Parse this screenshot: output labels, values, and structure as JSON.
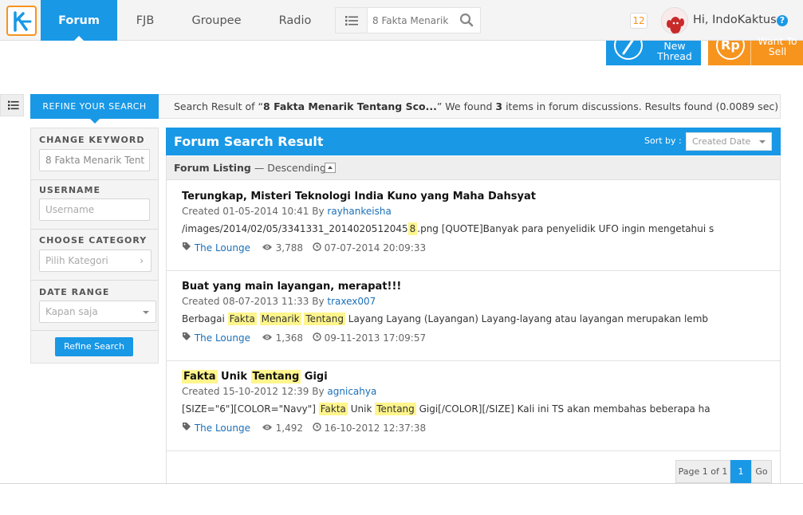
{
  "nav": {
    "tabs": [
      {
        "label": "Forum"
      },
      {
        "label": "FJB"
      },
      {
        "label": "Groupee"
      },
      {
        "label": "Radio"
      }
    ],
    "search_value": "8 Fakta Menarik",
    "notification_count": "12",
    "greeting": "Hi, IndoKaktus",
    "help": "?"
  },
  "actions": {
    "new_thread_line1": "New",
    "new_thread_line2": "Thread",
    "want_to_sell_line1": "Want To",
    "want_to_sell_line2": "Sell",
    "sell_icon_text": "Rp"
  },
  "refine": {
    "tab_label": "REFINE YOUR SEARCH",
    "change_keyword_label": "CHANGE KEYWORD",
    "keyword_value": "8 Fakta Menarik Tent",
    "username_label": "USERNAME",
    "username_placeholder": "Username",
    "category_label": "CHOOSE CATEGORY",
    "category_value": "Pilih Kategori",
    "date_range_label": "DATE RANGE",
    "date_range_value": "Kapan saja",
    "button_label": "Refine Search"
  },
  "summary": {
    "prefix": "Search Result of “",
    "query": "8 Fakta Menarik Tentang Sco...",
    "mid": "” We found ",
    "count": "3",
    "suffix": " items in forum discussions. Results found (0.0089 sec)"
  },
  "panel": {
    "title": "Forum Search Result",
    "sort_label": "Sort by :",
    "sort_value": "Created Date",
    "listing_label": "Forum Listing",
    "listing_order": " — Descending"
  },
  "results": [
    {
      "title_parts": [
        {
          "t": "Terungkap, Misteri Teknologi India Kuno yang Maha Dahsyat",
          "hl": false
        }
      ],
      "created_prefix": "Created 01-05-2014 10:41 By ",
      "user": "rayhankeisha",
      "snippet_parts": [
        {
          "t": "/images/2014/02/05/3341331_2014020512045",
          "hl": false
        },
        {
          "t": "8",
          "hl": true
        },
        {
          "t": ".png [QUOTE]Banyak para penyelidik UFO ingin mengetahui s",
          "hl": false
        }
      ],
      "category": "The Lounge",
      "views": "3,788",
      "last_post": "07-07-2014 20:09:33"
    },
    {
      "title_parts": [
        {
          "t": "Buat yang main layangan, merapat!!!",
          "hl": false
        }
      ],
      "created_prefix": "Created 08-07-2013 11:33 By ",
      "user": "traxex007",
      "snippet_parts": [
        {
          "t": "Berbagai ",
          "hl": false
        },
        {
          "t": "Fakta",
          "hl": true
        },
        {
          "t": " ",
          "hl": false
        },
        {
          "t": "Menarik",
          "hl": true
        },
        {
          "t": " ",
          "hl": false
        },
        {
          "t": "Tentang",
          "hl": true
        },
        {
          "t": " Layang Layang (Layangan) Layang-layang atau layangan merupakan lemb",
          "hl": false
        }
      ],
      "category": "The Lounge",
      "views": "1,368",
      "last_post": "09-11-2013 17:09:57"
    },
    {
      "title_parts": [
        {
          "t": "Fakta",
          "hl": true
        },
        {
          "t": " Unik ",
          "hl": false
        },
        {
          "t": "Tentang",
          "hl": true
        },
        {
          "t": " Gigi",
          "hl": false
        }
      ],
      "created_prefix": "Created 15-10-2012 12:39 By ",
      "user": "agnicahya",
      "snippet_parts": [
        {
          "t": "[SIZE=\"6\"][COLOR=\"Navy\"] ",
          "hl": false
        },
        {
          "t": "Fakta",
          "hl": true
        },
        {
          "t": " Unik ",
          "hl": false
        },
        {
          "t": "Tentang",
          "hl": true
        },
        {
          "t": " Gigi[/COLOR][/SIZE] Kali ini TS akan membahas beberapa ha",
          "hl": false
        }
      ],
      "category": "The Lounge",
      "views": "1,492",
      "last_post": "16-10-2012 12:37:38"
    }
  ],
  "pagination": {
    "info": "Page 1 of 1",
    "current": "1",
    "go": "Go"
  },
  "colors": {
    "primary": "#1998e6",
    "accent": "#f7941d",
    "highlight": "#fff58c",
    "link": "#1a6fb8"
  }
}
